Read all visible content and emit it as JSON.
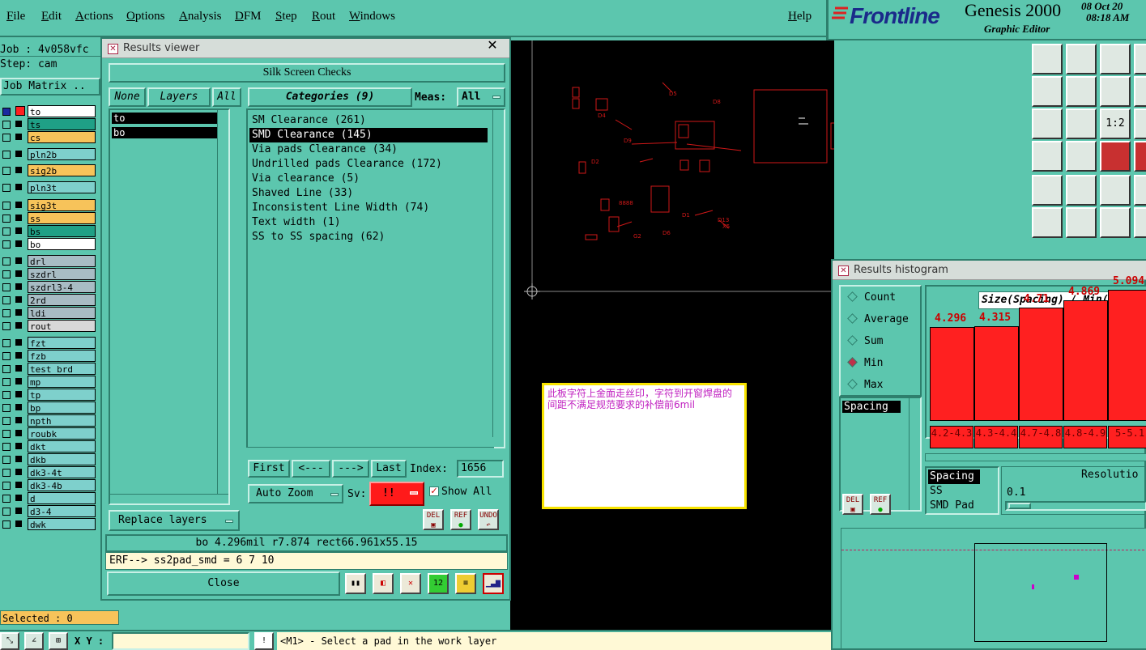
{
  "menu": [
    "File",
    "Edit",
    "Actions",
    "Options",
    "Analysis",
    "DFM",
    "Step",
    "Rout",
    "Windows"
  ],
  "help_label": "Help",
  "brand": {
    "logo": "Frontline",
    "product": "Genesis 2000",
    "subtitle": "Graphic Editor",
    "date": "08 Oct 20",
    "time": "08:18 AM"
  },
  "job": {
    "job_label": "Job : 4v058vfc",
    "step_label": "Step: cam",
    "matrix_label": "Job Matrix .."
  },
  "layers": [
    {
      "name": "to",
      "color": "#ffffff"
    },
    {
      "name": "ts",
      "color": "#1fa086"
    },
    {
      "name": "cs",
      "color": "#f7c35a"
    },
    {
      "name": "pln2b",
      "color": "#7ed0cc"
    },
    {
      "name": "sig2b",
      "color": "#f7c35a"
    },
    {
      "name": "pln3t",
      "color": "#7ed0cc"
    },
    {
      "name": "sig3t",
      "color": "#f7c35a"
    },
    {
      "name": "ss",
      "color": "#f7c35a"
    },
    {
      "name": "bs",
      "color": "#1fa086"
    },
    {
      "name": "bo",
      "color": "#ffffff"
    },
    {
      "name": "drl",
      "color": "#a8bcc4"
    },
    {
      "name": "szdrl",
      "color": "#a8bcc4"
    },
    {
      "name": "szdrl3-4",
      "color": "#a8bcc4"
    },
    {
      "name": "2rd",
      "color": "#a8bcc4"
    },
    {
      "name": "ldi",
      "color": "#a8bcc4"
    },
    {
      "name": "rout",
      "color": "#d8d8d8"
    },
    {
      "name": "fzt",
      "color": "#7ed0cc"
    },
    {
      "name": "fzb",
      "color": "#7ed0cc"
    },
    {
      "name": "test_brd",
      "color": "#7ed0cc"
    },
    {
      "name": "mp",
      "color": "#7ed0cc"
    },
    {
      "name": "tp",
      "color": "#7ed0cc"
    },
    {
      "name": "bp",
      "color": "#7ed0cc"
    },
    {
      "name": "npth",
      "color": "#7ed0cc"
    },
    {
      "name": "roubk",
      "color": "#7ed0cc"
    },
    {
      "name": "dkt",
      "color": "#7ed0cc"
    },
    {
      "name": "dkb",
      "color": "#7ed0cc"
    },
    {
      "name": "dk3-4t",
      "color": "#7ed0cc"
    },
    {
      "name": "dk3-4b",
      "color": "#7ed0cc"
    },
    {
      "name": "d",
      "color": "#7ed0cc"
    },
    {
      "name": "d3-4",
      "color": "#7ed0cc"
    },
    {
      "name": "dwk",
      "color": "#7ed0cc"
    }
  ],
  "selected_label": "Selected : 0",
  "results_viewer": {
    "title": "Results viewer",
    "heading": "Silk Screen Checks",
    "none_btn": "None",
    "layers_btn": "Layers",
    "all_btn": "All",
    "categories_btn": "Categories (9)",
    "meas_label": "Meas:",
    "meas_value": "All",
    "layer_list": [
      "to",
      "bo"
    ],
    "categories": [
      "SM Clearance (261)",
      "SMD Clearance (145)",
      "Via pads Clearance (34)",
      "Undrilled pads Clearance (172)",
      "Via clearance (5)",
      "Shaved Line (33)",
      "Inconsistent Line Width (74)",
      "Text width (1)",
      "SS to SS spacing (62)"
    ],
    "selected_category": 1,
    "first_btn": "First",
    "prev_btn": "<---",
    "next_btn": "--->",
    "last_btn": "Last",
    "index_label": "Index:",
    "index_value": "1656",
    "auto_zoom": "Auto Zoom",
    "sv_label": "Sv:",
    "sv_value": "!!",
    "show_all": "Show All",
    "replace_layers": "Replace layers",
    "del_label": "DEL",
    "ref_label": "REF",
    "undo_label": "UNDO",
    "measure_text": "bo 4.296mil  r7.874  rect66.961x55.15",
    "erf_text": "ERF--> ss2pad_smd = 6 7 10",
    "close_btn": "Close"
  },
  "note": {
    "text": "此板字符上金面走丝印，字符到开窗焊盘的间距不满足规范要求的补偿前6mil"
  },
  "histogram": {
    "title": "Results histogram",
    "modes": [
      "Count",
      "Average",
      "Sum",
      "Min",
      "Max"
    ],
    "selected_mode": "Min",
    "header": "Size(Spacing) / Min(Spa",
    "list_item": "Spacing",
    "bars": [
      {
        "value": "4.296",
        "bin": "4.2-4.3"
      },
      {
        "value": "4.315",
        "bin": "4.3-4.4"
      },
      {
        "value": "4.71",
        "bin": "4.7-4.8"
      },
      {
        "value": "4.869",
        "bin": "4.8-4.9"
      },
      {
        "value": "5.094",
        "bin": "5-5.1"
      }
    ],
    "types": [
      "Spacing",
      "SS",
      "SMD Pad"
    ],
    "resolution_label": "Resolutio",
    "resolution_value": "0.1",
    "del_label": "DEL",
    "ref_label": "REF"
  },
  "canvas_labels": [
    "D5",
    "D8",
    "D4",
    "D9",
    "D2",
    "D1",
    "D3",
    "D6",
    "G2",
    "D10",
    "D13",
    "X1",
    "X3",
    "8888"
  ],
  "status": {
    "xy_label": "X Y :",
    "message": "<M1> - Select a pad in the work layer"
  }
}
